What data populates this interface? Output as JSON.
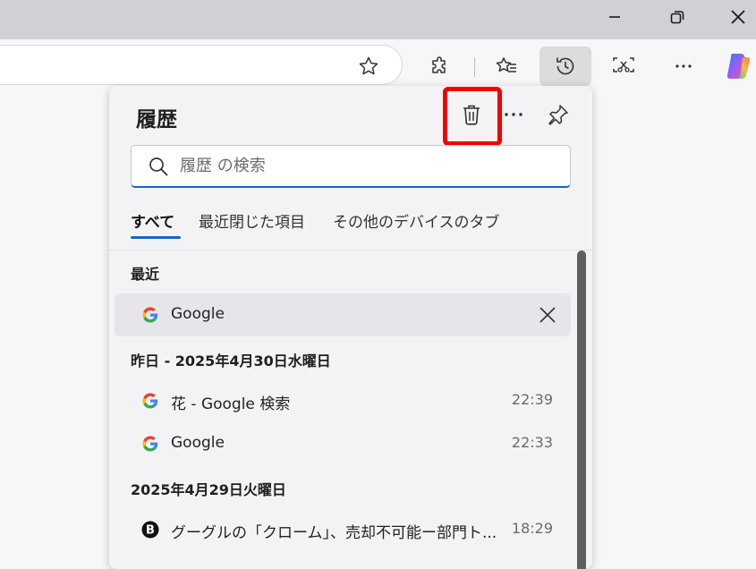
{
  "panel": {
    "title": "履歴",
    "search_placeholder": "履歴 の検索",
    "tabs": [
      {
        "label": "すべて"
      },
      {
        "label": "最近閉じた項目"
      },
      {
        "label": "その他のデバイスのタブ"
      }
    ],
    "sections": [
      {
        "heading": "最近",
        "items": [
          {
            "title": "Google",
            "time": ""
          }
        ]
      },
      {
        "heading": "昨日 - 2025年4月30日水曜日",
        "items": [
          {
            "title": "花 - Google 検索",
            "time": "22:39"
          },
          {
            "title": "Google",
            "time": "22:33"
          }
        ]
      },
      {
        "heading": "2025年4月29日火曜日",
        "items": [
          {
            "title": "グーグルの「クローム」、売却不可能ー部門ト...",
            "time": "18:29"
          }
        ]
      }
    ]
  },
  "colors": {
    "accent": "#1b63c3",
    "highlight": "#f20000",
    "panel_bg": "#f3f3f5"
  },
  "icons": {
    "minimize": "minimize-icon",
    "restore": "restore-icon",
    "close": "close-icon",
    "favorite": "star-icon",
    "extensions": "puzzle-icon",
    "favorites": "favorites-list-icon",
    "history": "history-icon",
    "screenshot": "screenshot-icon",
    "more": "more-icon",
    "copilot": "copilot-icon",
    "delete": "trash-icon",
    "pin": "pin-icon",
    "search": "search-icon"
  }
}
